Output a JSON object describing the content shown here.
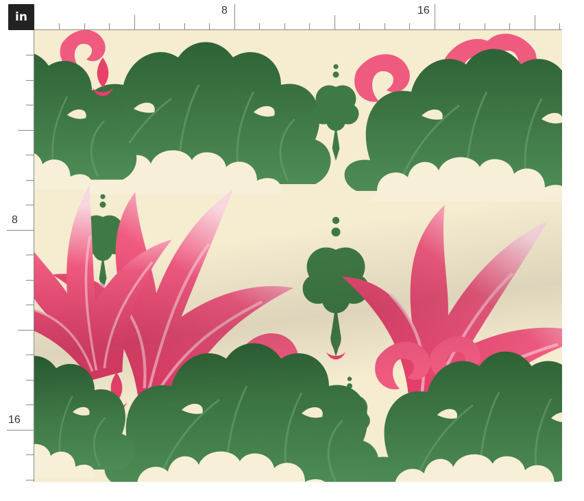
{
  "unit_toggle": {
    "label": "in"
  },
  "ruler_top": {
    "labels": [
      "8",
      "16"
    ]
  },
  "ruler_left": {
    "labels": [
      "8",
      "16"
    ]
  },
  "swatch": {
    "colors": {
      "background": "#f6ecd0",
      "green": "#3f7a45",
      "green_dark": "#2e5f35",
      "pink": "#e8406a",
      "pink_light": "#f07b98",
      "cream": "#f8efd8"
    },
    "motif": "damask"
  }
}
